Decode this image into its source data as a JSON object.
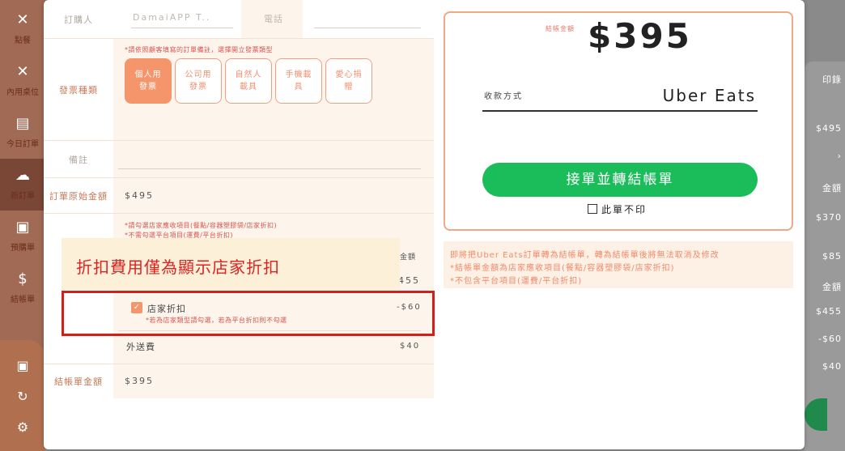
{
  "background": {
    "nav": [
      {
        "label": "點餐",
        "icon": "fork-knife-icon"
      },
      {
        "label": "內用桌位",
        "icon": "fork-knife-icon"
      },
      {
        "label": "今日訂單",
        "icon": "clipboard-icon"
      },
      {
        "label": "新訂單",
        "icon": "cloud-icon"
      },
      {
        "label": "預購單",
        "icon": "calendar-icon"
      },
      {
        "label": "結帳單",
        "icon": "dollar-receipt-icon"
      }
    ],
    "right_header": "印錄",
    "right_values": [
      "$495",
      "金額",
      "$370",
      "$85",
      "金額",
      "$455",
      "-$60",
      "$40"
    ]
  },
  "form": {
    "orderer_label": "訂購人",
    "orderer_placeholder": "DamaiAPP T..",
    "phone_label": "電話",
    "invoice_type_label": "發票種類",
    "invoice_hint": "*請依照顧客填寫的訂單備註，選擇開立發票類型",
    "invoice_options": [
      {
        "line1": "個人用",
        "line2": "發票",
        "active": true
      },
      {
        "line1": "公司用",
        "line2": "發票",
        "active": false
      },
      {
        "line1": "自然人",
        "line2": "載具",
        "active": false
      },
      {
        "line1": "手機載",
        "line2": "具",
        "active": false
      },
      {
        "line1": "愛心捐",
        "line2": "贈",
        "active": false
      }
    ],
    "note_label": "備註",
    "original_amount_label": "訂單原始金額",
    "original_amount": "$495",
    "items_hint_1": "*請勾選店家應收項目(餐點/容器塑膠袋/店家折扣)",
    "items_hint_2": "*不需勾選平台項目(運費/平台折扣)",
    "amount_header": "金額",
    "item_amount": "455",
    "discount_label": "店家折扣",
    "discount_amount": "-$60",
    "discount_hint": "*若為店家類型請勾選，若為平台折扣則不勾選",
    "delivery_label": "外送費",
    "delivery_amount": "$40",
    "checkout_amount_label": "結帳單金額",
    "checkout_amount": "$395"
  },
  "callout": "折扣費用僅為顯示店家折扣",
  "payment": {
    "amount_label": "結帳金額",
    "amount": "$395",
    "method_label": "收款方式",
    "method_value": "Uber Eats",
    "accept_button": "接單並轉結帳單",
    "no_print_label": "此單不印"
  },
  "notes": [
    "即將把Uber Eats訂單轉為結帳單，轉為結帳單後將無法取消及修改",
    "*結帳單金額為店家應收項目(餐點/容器塑膠袋/店家折扣)",
    "*不包含平台項目(運費/平台折扣)"
  ],
  "colors": {
    "accent": "#f4956c",
    "accept_green": "#1abd5a",
    "highlight_red": "#d0201c"
  }
}
